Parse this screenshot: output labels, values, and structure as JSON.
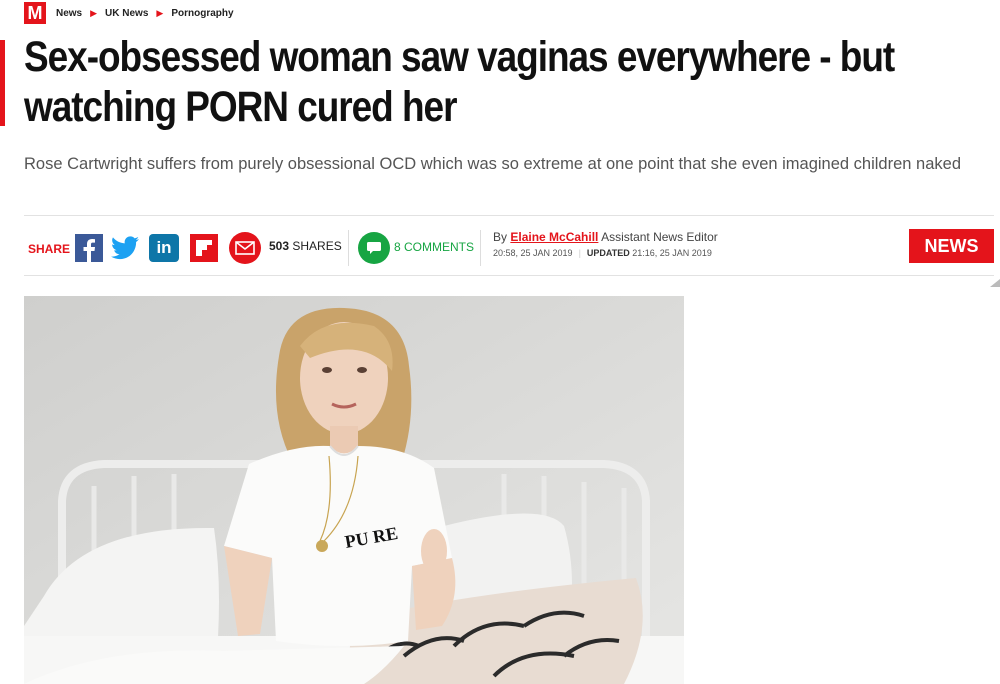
{
  "logo": {
    "letter": "M"
  },
  "breadcrumb": [
    "News",
    "UK News",
    "Pornography"
  ],
  "headline": "Sex-obsessed woman saw vaginas everywhere - but watching PORN cured her",
  "standfirst": "Rose Cartwright suffers from purely obsessional OCD which was so extreme at one point that she even imagined children naked",
  "share": {
    "label": "SHARE",
    "count": "503",
    "count_suffix": "SHARES",
    "icons": [
      "facebook-icon",
      "twitter-icon",
      "linkedin-icon",
      "flipboard-icon",
      "email-icon"
    ]
  },
  "comments": {
    "label": "8 COMMENTS"
  },
  "byline": {
    "prefix": "By",
    "author": "Elaine McCahill",
    "role": "Assistant News Editor",
    "published": "20:58, 25 JAN 2019",
    "updated_label": "UPDATED",
    "updated": "21:16, 25 JAN 2019"
  },
  "section_badge": "NEWS",
  "photo": {
    "shirt_text": "PU RE"
  },
  "colors": {
    "brand": "#e4141b",
    "comments": "#17a543",
    "facebook": "#3b5998",
    "linkedin": "#0e76a8",
    "twitter": "#1da1f2"
  }
}
